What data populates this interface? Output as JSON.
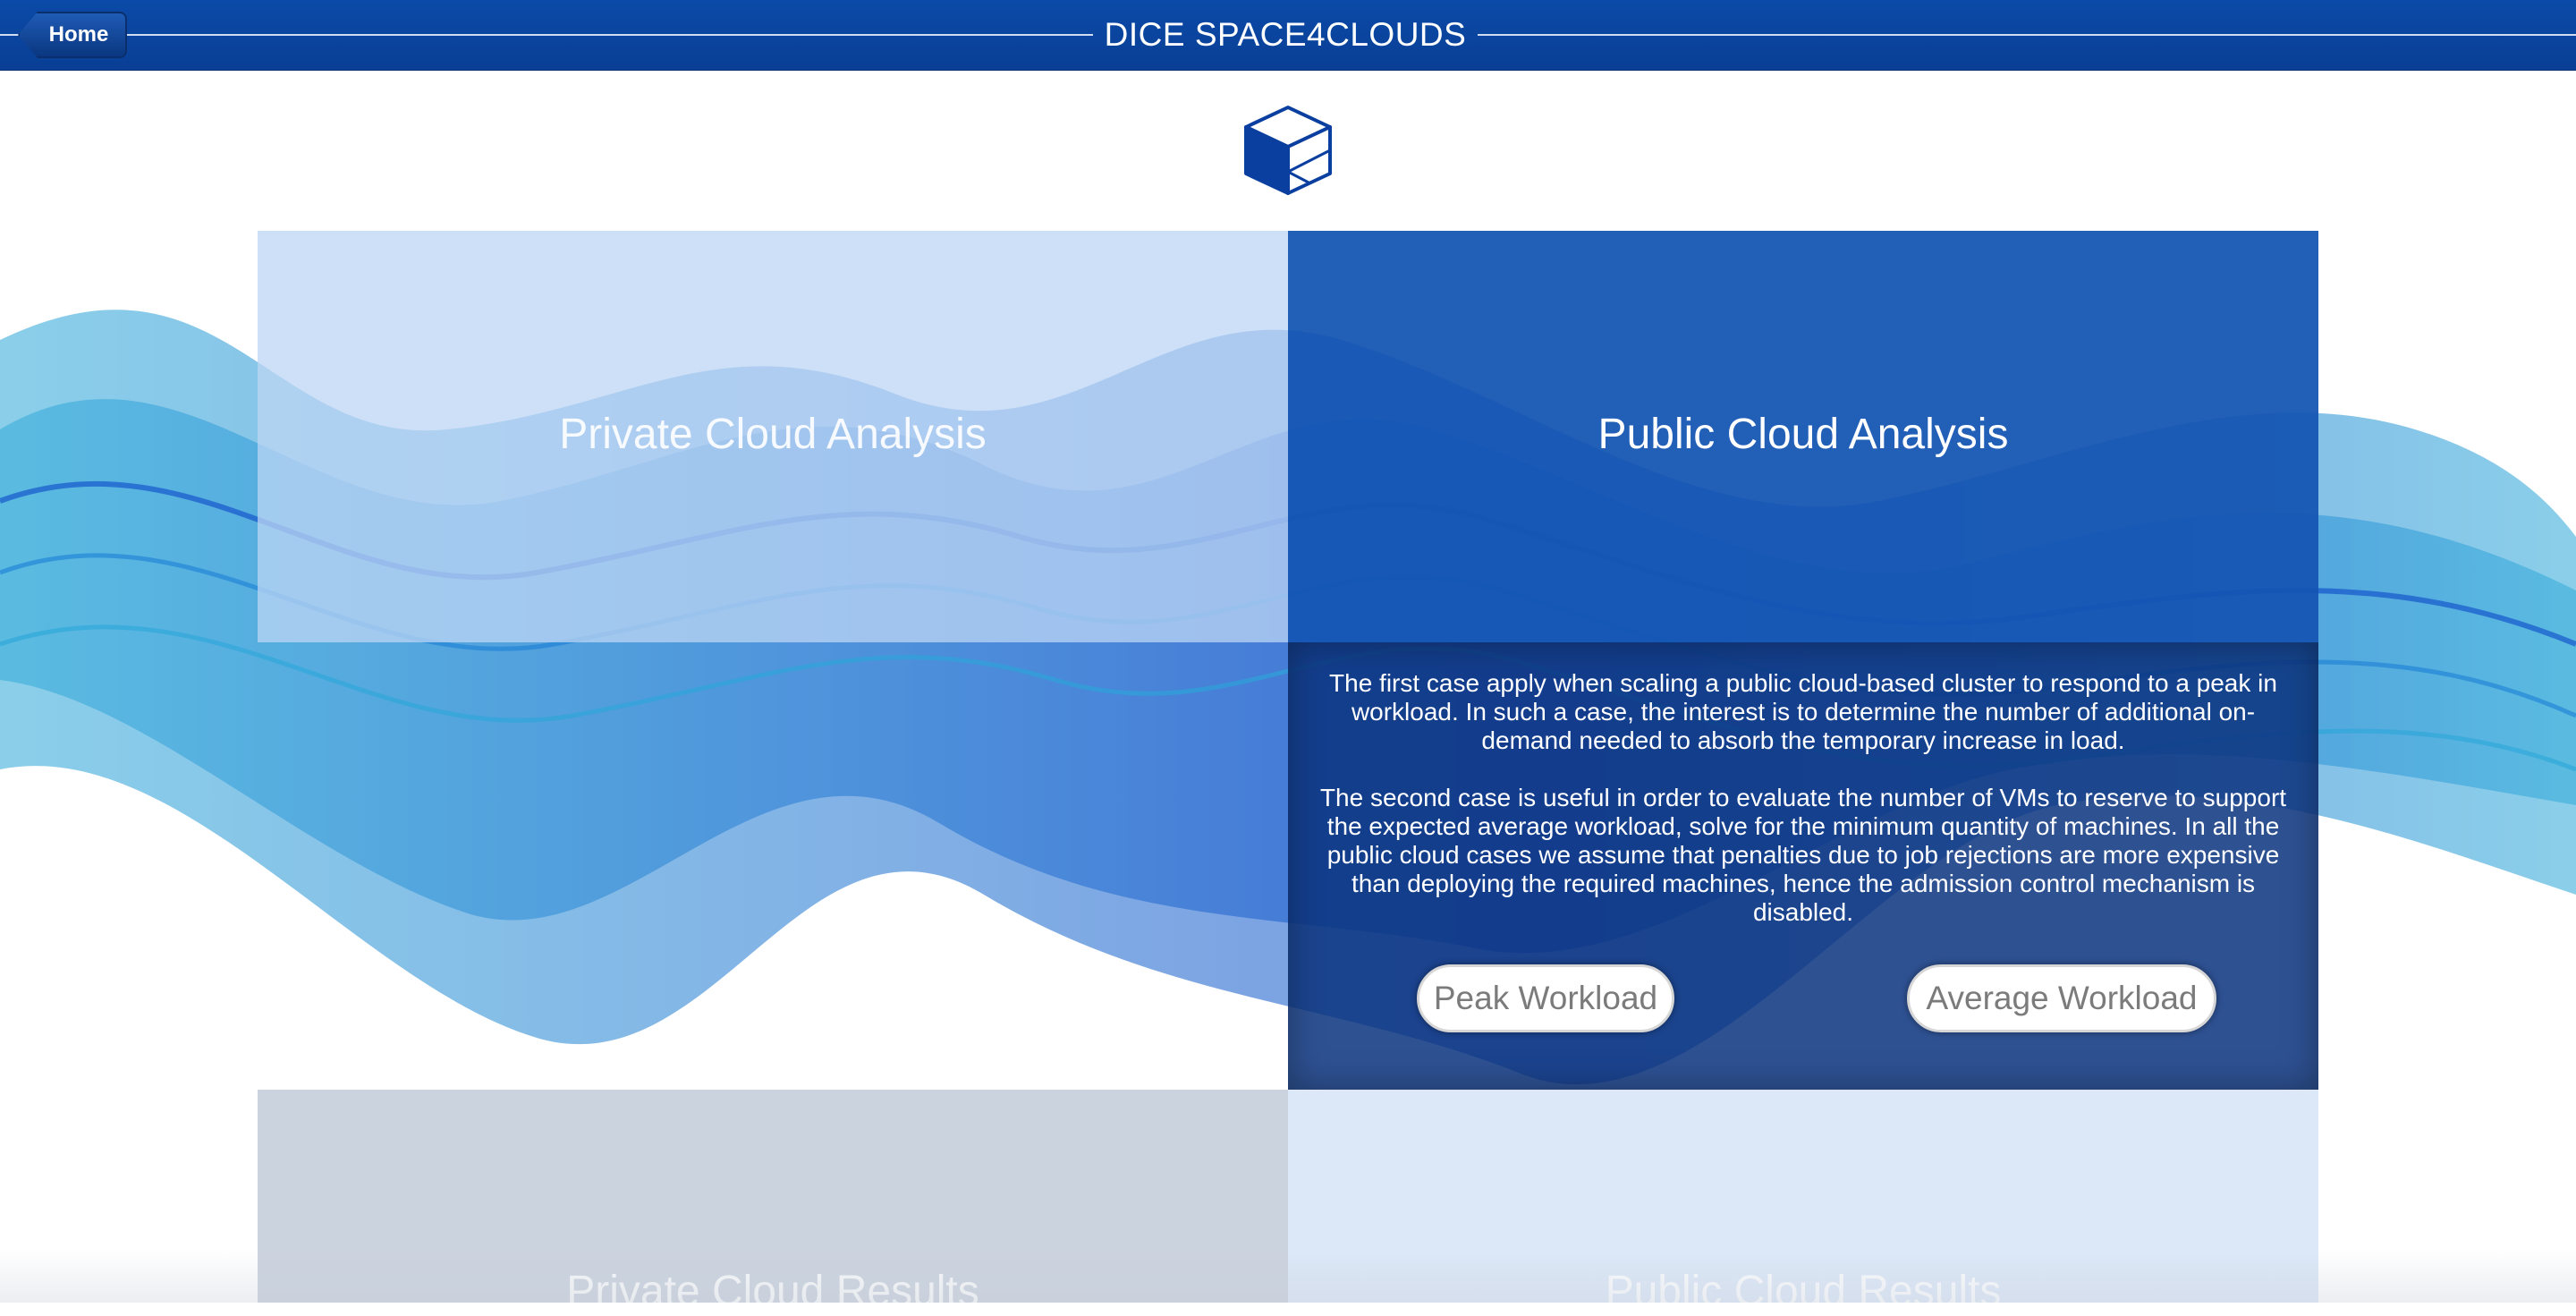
{
  "header": {
    "title": "DICE SPACE4CLOUDS",
    "home_label": "Home"
  },
  "logo": {
    "icon": "cube-icon"
  },
  "panels": {
    "private_analysis": {
      "title": "Private Cloud Analysis"
    },
    "public_analysis": {
      "title": "Public Cloud Analysis",
      "paragraph_1": "The first case apply when scaling a public cloud-based cluster to respond to a peak in workload. In such a case, the interest is to determine the number of additional on-demand needed to absorb the temporary increase in load.",
      "paragraph_2": "The second case is useful in order to evaluate the number of VMs to reserve to support the expected average workload, solve for the minimum quantity of machines. In all the public cloud cases we assume that penalties due to job rejections are more expensive than deploying the required machines, hence the admission control mechanism is disabled.",
      "peak_button": "Peak Workload",
      "average_button": "Average Workload"
    },
    "private_results": {
      "title": "Private Cloud Results"
    },
    "public_results": {
      "title": "Public Cloud Results"
    }
  },
  "colors": {
    "header_bg": "#0b4aa8",
    "accent_blue": "#1455b2",
    "wave_cyan": "#2aa7d8",
    "wave_blue": "#0a48c8"
  }
}
